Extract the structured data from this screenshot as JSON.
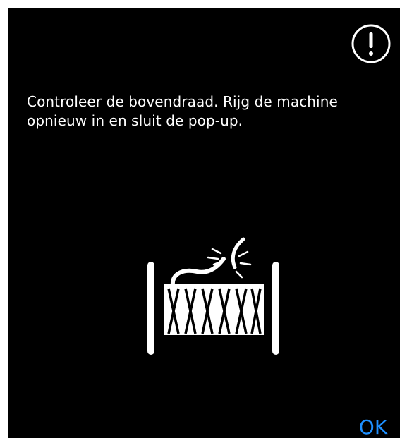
{
  "dialog": {
    "message": "Controleer de bovendraad. Rijg de machine opnieuw in en sluit de pop-up.",
    "icon": "exclamation-circle-icon",
    "illustration": "broken-thread-spool-icon",
    "ok_label": "OK"
  },
  "colors": {
    "background": "#000000",
    "text": "#ffffff",
    "accent": "#1e90ff"
  }
}
